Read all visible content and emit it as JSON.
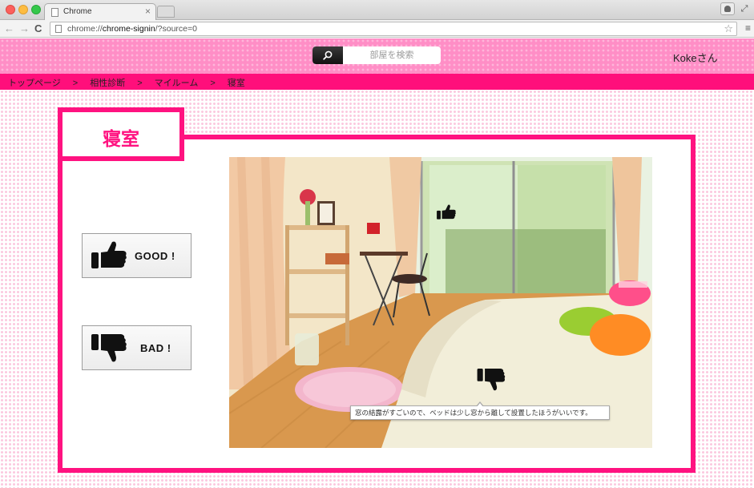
{
  "browser": {
    "tab_title": "Chrome",
    "tab_close": "×",
    "url_prefix": "chrome://",
    "url_host": "chrome-signin",
    "url_path": "/?source=0",
    "nav": {
      "back": "←",
      "forward": "→",
      "reload": "C"
    },
    "star": "☆",
    "menu": "≡"
  },
  "header": {
    "search_placeholder": "部屋を検索",
    "user_name": "Kokeさん",
    "color": "#ff8ec6"
  },
  "breadcrumb": {
    "items": [
      "トップページ",
      "相性診断",
      "マイルーム",
      "寝室"
    ],
    "separator": ">",
    "color": "#ff0f7b"
  },
  "room": {
    "title": "寝室",
    "accent": "#ff1280"
  },
  "buttons": {
    "good_label": "GOOD !",
    "bad_label": "BAD !"
  },
  "photo": {
    "comment": "窓の結露がすごいので、ベッドは少し窓から離して設置したほうがいいです。"
  }
}
